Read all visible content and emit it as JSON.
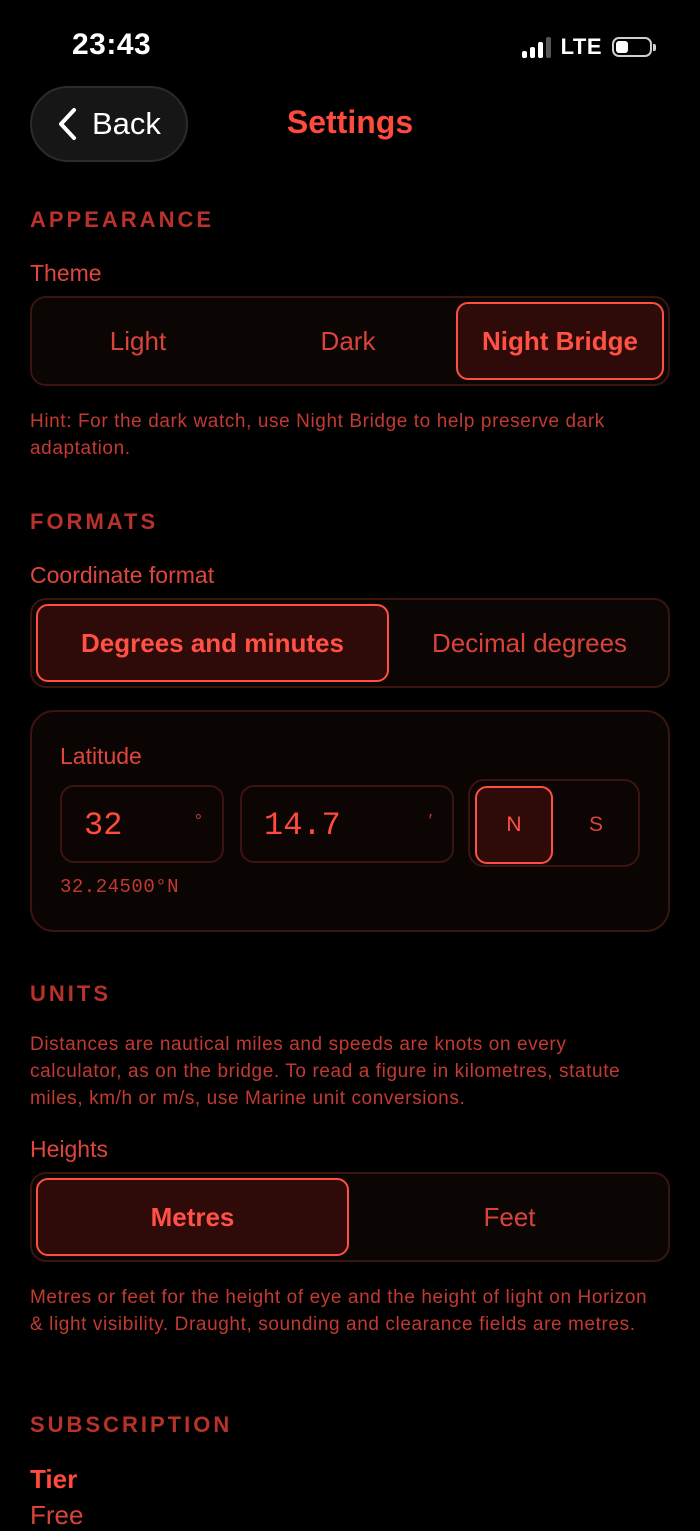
{
  "status_bar": {
    "time": "23:43",
    "network": "LTE"
  },
  "nav": {
    "back_label": "Back",
    "title": "Settings"
  },
  "appearance": {
    "section_title": "APPEARANCE",
    "theme_label": "Theme",
    "theme_options": [
      "Light",
      "Dark",
      "Night Bridge"
    ],
    "theme_selected": "Night Bridge",
    "hint": "Hint: For the dark watch, use Night Bridge to help preserve dark adaptation."
  },
  "formats": {
    "section_title": "FORMATS",
    "coordinate_label": "Coordinate format",
    "coordinate_options": [
      "Degrees and minutes",
      "Decimal degrees"
    ],
    "coordinate_selected": "Degrees and minutes",
    "latitude": {
      "label": "Latitude",
      "degrees": "32",
      "degrees_unit": "°",
      "minutes": "14.7",
      "minutes_unit": "′",
      "hemisphere_options": [
        "N",
        "S"
      ],
      "hemisphere_selected": "N",
      "readout": "32.24500°N"
    }
  },
  "units": {
    "section_title": "UNITS",
    "description": "Distances are nautical miles and speeds are knots on every calculator, as on the bridge. To read a figure in kilometres, statute miles, km/h or m/s, use Marine unit conversions.",
    "heights_label": "Heights",
    "heights_options": [
      "Metres",
      "Feet"
    ],
    "heights_selected": "Metres",
    "heights_hint": "Metres or feet for the height of eye and the height of light on Horizon & light visibility. Draught, sounding and clearance fields are metres."
  },
  "subscription": {
    "section_title": "SUBSCRIPTION",
    "tier_label": "Tier",
    "tier_value": "Free"
  },
  "colors": {
    "background": "#000000",
    "accent": "#ff4a3d",
    "section": "#b8322b",
    "border": "#3a1410"
  }
}
